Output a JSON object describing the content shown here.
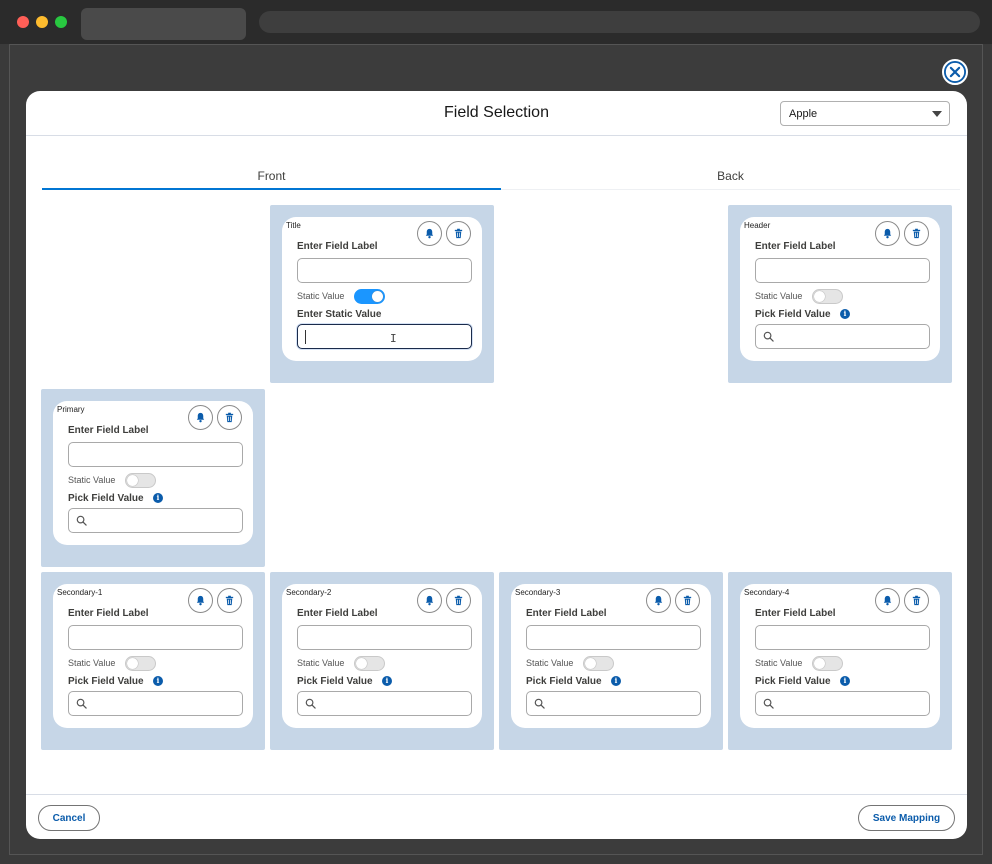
{
  "modal": {
    "title": "Field Selection",
    "selected_object": "Apple",
    "tabs": [
      "Front",
      "Back"
    ],
    "active_tab": "Front",
    "cancel_label": "Cancel",
    "save_label": "Save Mapping"
  },
  "common": {
    "field_label_heading": "Enter Field Label",
    "static_value_label": "Static Value",
    "static_value_heading": "Enter Static Value",
    "pick_field_heading": "Pick Field Value",
    "info_glyph": "i"
  },
  "slots": {
    "title": {
      "name": "Title",
      "static_on": true
    },
    "header": {
      "name": "Header",
      "static_on": false
    },
    "primary": {
      "name": "Primary",
      "static_on": false
    },
    "secondary_1": {
      "name": "Secondary-1",
      "static_on": false
    },
    "secondary_2": {
      "name": "Secondary-2",
      "static_on": false
    },
    "secondary_3": {
      "name": "Secondary-3",
      "static_on": false
    },
    "secondary_4": {
      "name": "Secondary-4",
      "static_on": false
    }
  },
  "icons": {
    "close": "close-icon",
    "bell": "bell-icon",
    "trash": "trash-icon",
    "search": "search-icon",
    "info": "info-icon",
    "dropdown": "chevron-down-icon"
  },
  "colors": {
    "accent": "#0176d3",
    "toggle_on": "#1b96ff",
    "cell_background": "#c6d6e7",
    "button_text": "#0b5cab"
  }
}
